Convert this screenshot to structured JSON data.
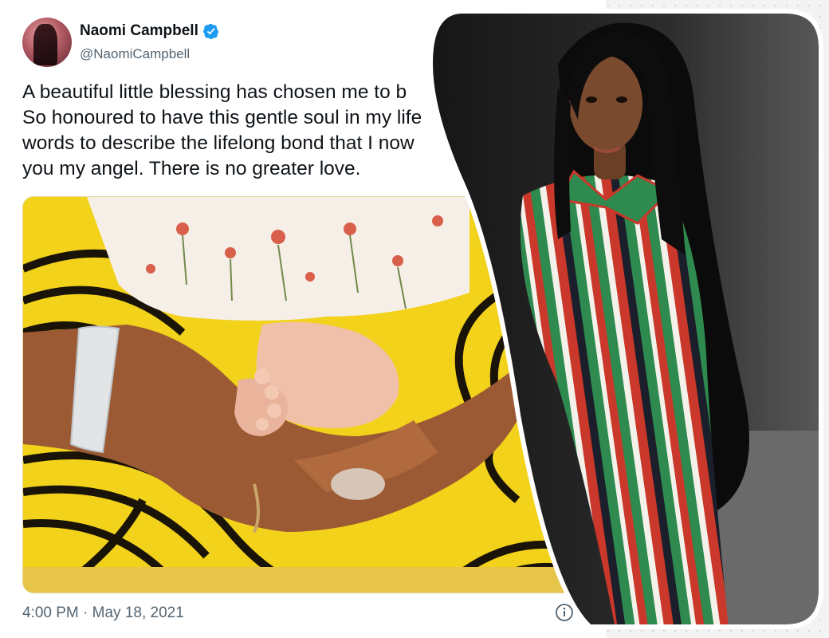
{
  "tweet": {
    "author_name": "Naomi Campbell",
    "author_handle": "@NaomiCampbell",
    "verified": true,
    "text_lines": [
      "A beautiful little blessing has chosen me to b",
      "So honoured to have this gentle soul in my life",
      "words to describe the lifelong bond that I now",
      "you my angel. There is no greater love."
    ],
    "timestamp": "4:00 PM · May 18, 2021",
    "icons": {
      "verified": "verified-badge-icon",
      "info": "info-icon"
    }
  },
  "colors": {
    "verified_blue": "#1d9bf0",
    "text_primary": "#0f1419",
    "text_secondary": "#536471",
    "fabric_yellow": "#f2d21a",
    "runway_dark": "#1e1e1e"
  }
}
